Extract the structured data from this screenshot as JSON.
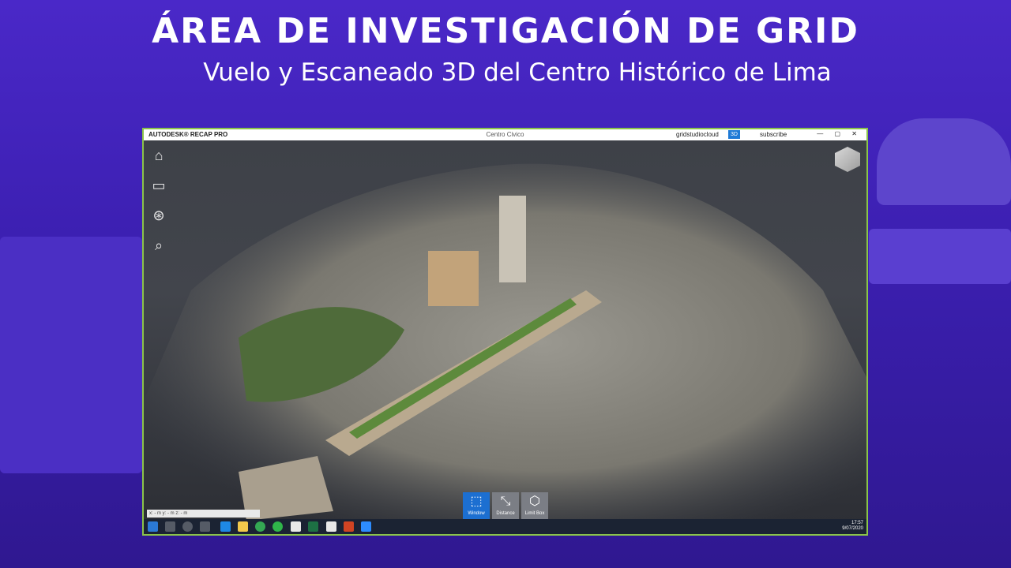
{
  "slide": {
    "title": "ÁREA DE INVESTIGACIÓN DE GRID",
    "subtitle": "Vuelo y Escaneado 3D del Centro Histórico de Lima"
  },
  "app": {
    "brand": "AUTODESK® RECAP PRO",
    "window_title": "Centro Civico",
    "user": "gridstudiocloud",
    "mode_badge": "3D",
    "subscribe": "subscribe",
    "window_buttons": "— ▢ ✕"
  },
  "sidebar": [
    {
      "name": "home-icon",
      "glyph": "⌂"
    },
    {
      "name": "display-icon",
      "glyph": "▭"
    },
    {
      "name": "navigation-wheel-icon",
      "glyph": "⊛"
    },
    {
      "name": "search-icon",
      "glyph": "⌕"
    }
  ],
  "tools": [
    {
      "label": "Window",
      "glyph": "⬚",
      "active": true
    },
    {
      "label": "Distance",
      "glyph": "⤡",
      "active": false
    },
    {
      "label": "Limit Box",
      "glyph": "⬡",
      "active": false
    }
  ],
  "coords_text": "x: - m      y: - m      z: - m",
  "clock": {
    "time": "17:57",
    "date": "9/07/2020"
  }
}
